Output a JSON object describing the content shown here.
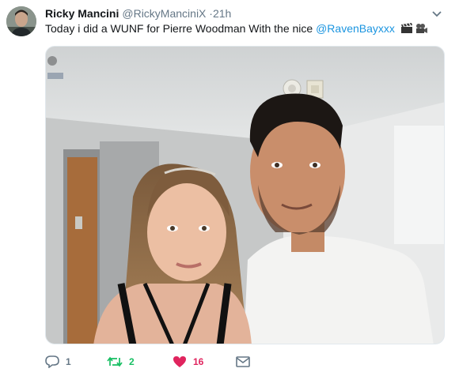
{
  "tweet": {
    "author_name": "Ricky Mancini",
    "author_handle": "@RickyManciniX",
    "separator": "·",
    "time": "21h",
    "text_prefix": "Today i did a WUNF for Pierre Woodman With the nice ",
    "mention": "@RavenBayxxx",
    "emojis": [
      "clapper-board-emoji",
      "movie-camera-emoji"
    ]
  },
  "actions": {
    "reply_count": "1",
    "retweet_count": "2",
    "like_count": "16"
  },
  "colors": {
    "mention": "#1b95e0",
    "retweet": "#17bf63",
    "like": "#e0245e",
    "muted": "#657786"
  },
  "icons": {
    "caret": "chevron-down-icon",
    "reply": "reply-icon",
    "retweet": "retweet-icon",
    "like": "heart-icon",
    "dm": "envelope-icon"
  }
}
